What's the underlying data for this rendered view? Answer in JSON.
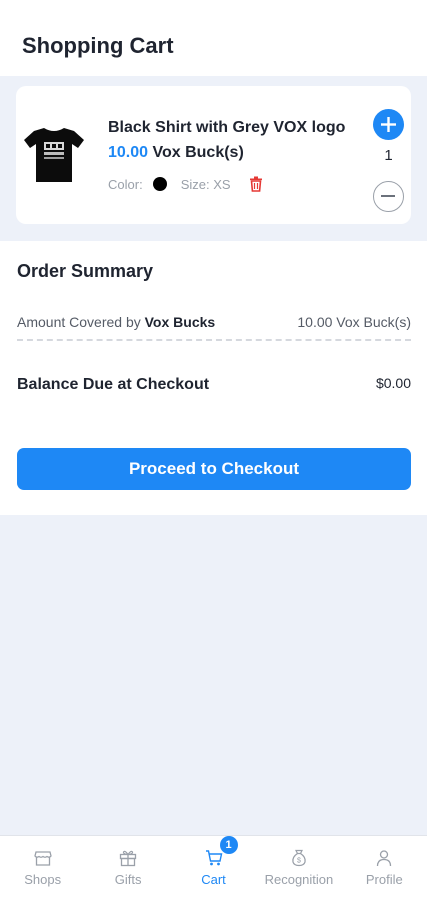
{
  "header": {
    "title": "Shopping Cart"
  },
  "cart": {
    "items": [
      {
        "name": "Black Shirt with Grey VOX logo",
        "price": "10.00",
        "price_unit": "Vox Buck(s)",
        "color_label": "Color:",
        "color_value": "#000000",
        "size_label": "Size: XS",
        "quantity": "1"
      }
    ]
  },
  "summary": {
    "title": "Order Summary",
    "covered_label_prefix": "Amount Covered by",
    "covered_label_bold": "Vox Bucks",
    "covered_value": "10.00 Vox Buck(s)",
    "balance_label": "Balance Due at Checkout",
    "balance_value": "$0.00",
    "checkout_label": "Proceed to Checkout"
  },
  "tabbar": {
    "tabs": [
      {
        "label": "Shops",
        "icon": "shop-icon",
        "active": false
      },
      {
        "label": "Gifts",
        "icon": "gift-icon",
        "active": false
      },
      {
        "label": "Cart",
        "icon": "cart-icon",
        "active": true,
        "badge": "1"
      },
      {
        "label": "Recognition",
        "icon": "recognition-icon",
        "active": false
      },
      {
        "label": "Profile",
        "icon": "profile-icon",
        "active": false
      }
    ]
  },
  "colors": {
    "accent": "#1e88f5",
    "background": "#edf1f9",
    "delete": "#e53935"
  }
}
